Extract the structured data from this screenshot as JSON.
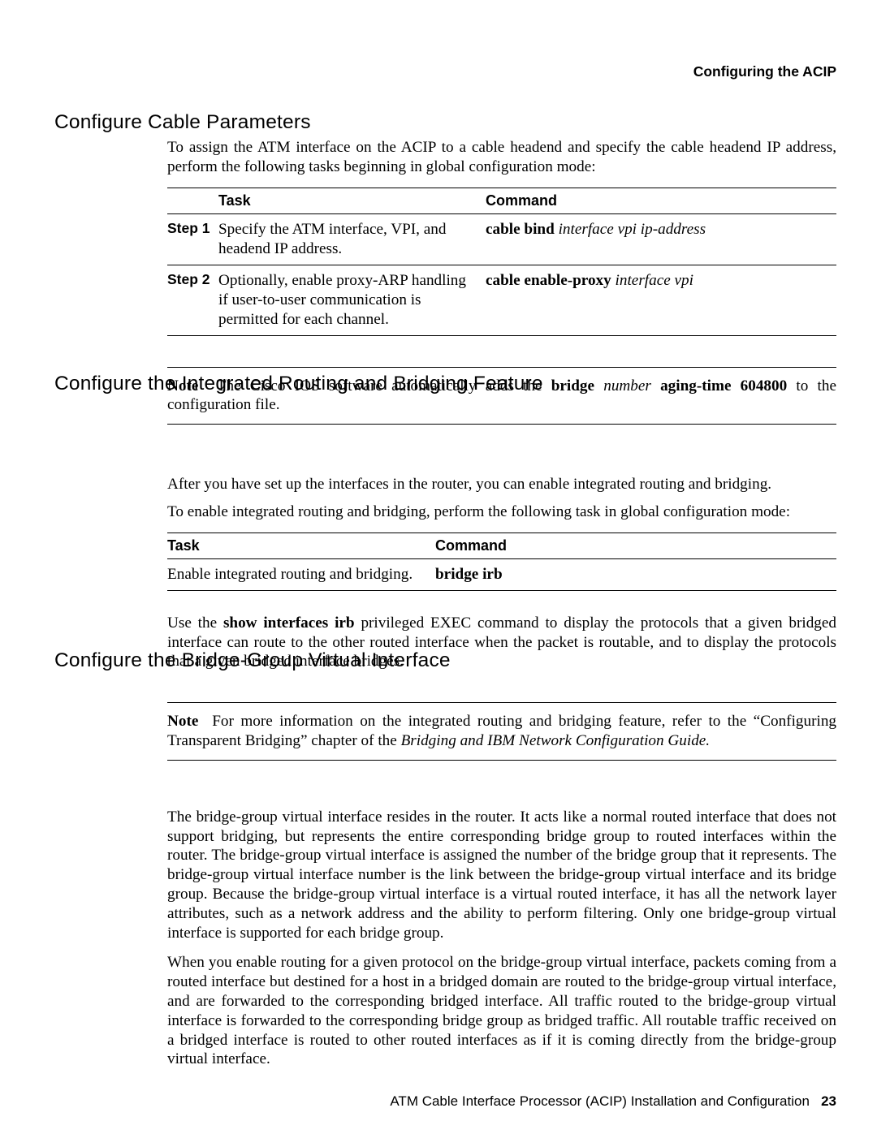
{
  "running_head": "Configuring the ACIP",
  "section1": {
    "heading": "Configure Cable Parameters",
    "intro": "To assign the ATM interface on the ACIP to a cable headend and specify the cable headend IP address, perform the following tasks beginning in global configuration mode:",
    "table": {
      "head_task": "Task",
      "head_cmd": "Command",
      "rows": [
        {
          "step": "Step 1",
          "task": "Specify the ATM interface, VPI, and headend IP address.",
          "cmd_bold": "cable bind",
          "cmd_ital": "interface vpi ip-address"
        },
        {
          "step": "Step 2",
          "task": "Optionally, enable proxy-ARP handling if user-to-user communication is permitted for each channel.",
          "cmd_bold": "cable enable-proxy",
          "cmd_ital": "interface vpi"
        }
      ]
    },
    "note": {
      "label": "Note",
      "pre": "The Cisco IOS software automatically adds the ",
      "b1": "bridge",
      "i1": "number",
      "b2": "aging-time 604800",
      "post": " to the configuration file."
    }
  },
  "section2": {
    "heading": "Configure the Integrated Routing and Bridging Feature",
    "p1": "After you have set up the interfaces in the router, you can enable integrated routing and bridging.",
    "p2": "To enable integrated routing and bridging, perform the following task in global configuration mode:",
    "table": {
      "head_task": "Task",
      "head_cmd": "Command",
      "task": "Enable integrated routing and bridging.",
      "cmd": "bridge irb"
    },
    "p3_pre": "Use the ",
    "p3_bold": "show interfaces irb",
    "p3_post": " privileged EXEC command to display the protocols that a given bridged interface can route to the other routed interface when the packet is routable, and to display the protocols that a given bridged interface bridges.",
    "note": {
      "label": "Note",
      "pre": "For more information on the integrated routing and bridging feature, refer to the “Configuring Transparent Bridging” chapter of the ",
      "ital": "Bridging and IBM Network Configuration Guide.",
      "post": ""
    }
  },
  "section3": {
    "heading": "Configure the Bridge-Group Virtual Interface",
    "p1": "The bridge-group virtual interface resides in the router. It acts like a normal routed interface that does not support bridging, but represents the entire corresponding bridge group to routed interfaces within the router. The bridge-group virtual interface is assigned the number of the bridge group that it represents. The bridge-group virtual interface number is the link between the bridge-group virtual interface and its bridge group. Because the bridge-group virtual interface is a virtual routed interface, it has all the network layer attributes, such as a network address and the ability to perform filtering. Only one bridge-group virtual interface is supported for each bridge group.",
    "p2": "When you enable routing for a given protocol on the bridge-group virtual interface, packets coming from a routed interface but destined for a host in a bridged domain are routed to the bridge-group virtual interface, and are forwarded to the corresponding bridged interface. All traffic routed to the bridge-group virtual interface is forwarded to the corresponding bridge group as bridged traffic. All routable traffic received on a bridged interface is routed to other routed interfaces as if it is coming directly from the bridge-group virtual interface."
  },
  "footer": {
    "title": "ATM Cable Interface Processor (ACIP) Installation and Configuration",
    "page": "23"
  }
}
